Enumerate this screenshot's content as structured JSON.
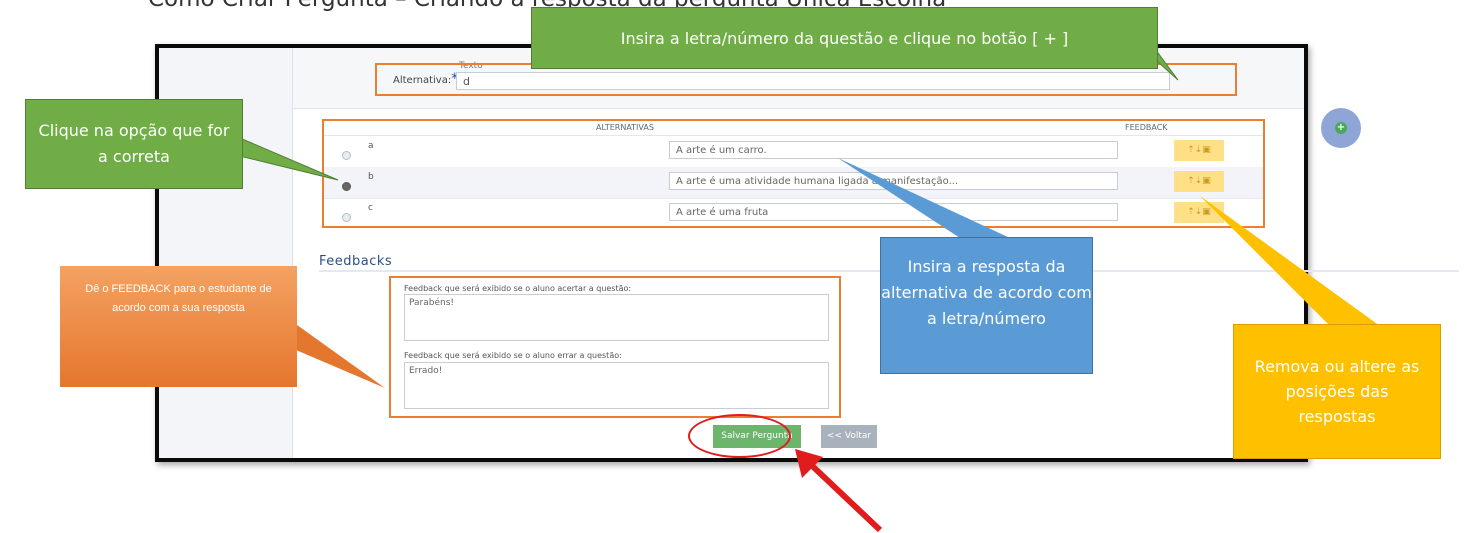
{
  "document": {
    "title": "Como Criar Pergunta – Criando a resposta da pergunta Única Escolha"
  },
  "form": {
    "texto_label": "Texto",
    "alternative_label": "Alternativa:",
    "required_mark": "*",
    "alternative_value": "d",
    "add_button": "+"
  },
  "alternatives_table": {
    "header_alternatives": "ALTERNATIVAS",
    "header_feedback": "FEEDBACK",
    "rows": [
      {
        "letter": "a",
        "answer": "A arte é um carro.",
        "selected": false
      },
      {
        "letter": "b",
        "answer": "A arte é uma atividade humana ligada a manifestação...",
        "selected": true
      },
      {
        "letter": "c",
        "answer": "A arte é uma fruta",
        "selected": false
      }
    ],
    "tools_glyph": "⇡⇣▣"
  },
  "feedbacks": {
    "heading": "Feedbacks",
    "correct_label": "Feedback que será exibido se o aluno acertar a questão:",
    "correct_value": "Parabéns!",
    "wrong_label": "Feedback que será exibido se o aluno errar a questão:",
    "wrong_value": "Errado!"
  },
  "buttons": {
    "save": "Salvar Pergunta",
    "back": "<< Voltar"
  },
  "callouts": {
    "top_green": "Insira a letra/número da questão e clique no botão [ + ]",
    "left_green": "Clique na opção que for a correta",
    "left_orange": "Dê o FEEDBACK para o estudante de acordo com a sua resposta",
    "mid_blue": "Insira a resposta da alternativa de acordo com a letra/número",
    "right_yellow": "Remova ou altere as posições das respostas"
  },
  "colors": {
    "highlight_border": "#ed7d31",
    "callout_green": "#70ad47",
    "callout_blue": "#5b9bd5",
    "callout_yellow": "#ffc000",
    "callout_orange": "#ed7d31",
    "arrow_red": "#e01c1c"
  }
}
